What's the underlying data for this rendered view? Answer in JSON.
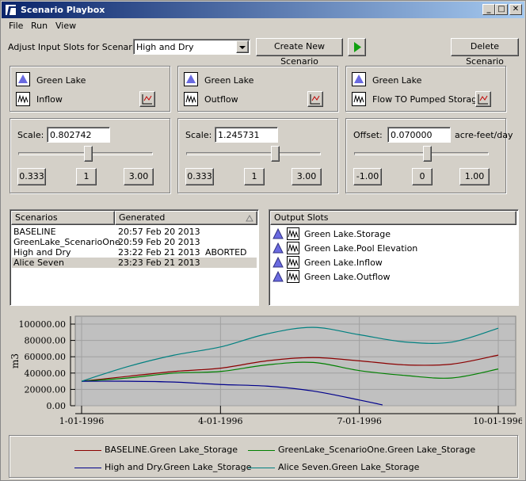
{
  "window": {
    "title": "Scenario Playbox",
    "min": "_",
    "max": "□",
    "close": "✕"
  },
  "menu": [
    "File",
    "Run",
    "View"
  ],
  "toolbar": {
    "adjust_label": "Adjust Input Slots for Scenario:",
    "scenario_select": "High and Dry",
    "create_button": "Create New Scenario",
    "run_button_icon": "play-icon",
    "delete_button": "Delete Scenario"
  },
  "slots": [
    {
      "object": "Green Lake",
      "slot": "Inflow",
      "adjust_label": "Scale:",
      "value": "0.802742",
      "unit": "",
      "ticks": [
        "0.333",
        "1",
        "3.00"
      ],
      "thumb_level": 0.52
    },
    {
      "object": "Green Lake",
      "slot": "Outflow",
      "adjust_label": "Scale:",
      "value": "1.245731",
      "unit": "",
      "ticks": [
        "0.333",
        "1",
        "3.00"
      ],
      "thumb_level": 0.66
    },
    {
      "object": "Green Lake",
      "slot": "Flow TO Pumped Storage",
      "adjust_label": "Offset:",
      "value": "0.070000",
      "unit": "acre-feet/day",
      "ticks": [
        "-1.00",
        "0",
        "1.00"
      ],
      "thumb_level": 0.54
    }
  ],
  "scenarios": {
    "headers": [
      "Scenarios",
      "Generated"
    ],
    "rows": [
      {
        "name": "BASELINE",
        "generated": "20:57 Feb 20 2013",
        "status": ""
      },
      {
        "name": "GreenLake_ScenarioOne",
        "generated": "20:59 Feb 20 2013",
        "status": ""
      },
      {
        "name": "High and Dry",
        "generated": "23:22 Feb 21 2013",
        "status": "ABORTED"
      },
      {
        "name": "Alice Seven",
        "generated": "23:23 Feb 21 2013",
        "status": ""
      }
    ]
  },
  "output_slots": {
    "header": "Output Slots",
    "items": [
      "Green Lake.Storage",
      "Green Lake.Pool Elevation",
      "Green Lake.Inflow",
      "Green Lake.Outflow"
    ]
  },
  "colors": {
    "baseline": "#8b0000",
    "scenario_one": "#008000",
    "high_dry": "#00008b",
    "alice": "#008080",
    "plot_bg": "#c0c0c0"
  },
  "chart_data": {
    "type": "line",
    "ylabel": "m3",
    "ylim": [
      0,
      100000
    ],
    "yticks": [
      "100000.00",
      "80000.00",
      "60000.00",
      "40000.00",
      "20000.00",
      "0.00"
    ],
    "xticks": [
      "1-01-1996",
      "4-01-1996",
      "7-01-1996",
      "10-01-1996"
    ],
    "xlim_months": [
      0,
      9
    ],
    "series": [
      {
        "name": "BASELINE.Green Lake_Storage",
        "x": [
          0,
          1,
          2,
          3,
          4,
          5,
          6,
          7,
          8,
          9
        ],
        "values": [
          30000,
          36000,
          42000,
          46000,
          55000,
          59000,
          55000,
          50000,
          51000,
          62000
        ]
      },
      {
        "name": "GreenLake_ScenarioOne.Green Lake_Storage",
        "x": [
          0,
          1,
          2,
          3,
          4,
          5,
          6,
          7,
          8,
          9
        ],
        "values": [
          30000,
          34000,
          40000,
          42000,
          50000,
          53000,
          43000,
          37000,
          34000,
          45000
        ]
      },
      {
        "name": "High and Dry.Green Lake_Storage",
        "x": [
          0,
          1,
          2,
          3,
          4,
          5,
          6,
          6.5
        ],
        "values": [
          30000,
          30000,
          29000,
          26000,
          24000,
          18000,
          7000,
          1000
        ]
      },
      {
        "name": "Alice Seven.Green Lake_Storage",
        "x": [
          0,
          1,
          2,
          3,
          4,
          5,
          6,
          7,
          8,
          9
        ],
        "values": [
          30000,
          48000,
          62000,
          72000,
          88000,
          96000,
          87000,
          78000,
          78000,
          95000
        ]
      }
    ]
  }
}
